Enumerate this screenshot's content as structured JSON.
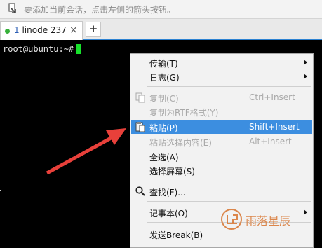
{
  "hint_bar": {
    "icon": "add-session-hint-icon",
    "text": "要添加当前会话，点击左侧的箭头按钮。"
  },
  "tabs": [
    {
      "number": "1",
      "name": "linode 237",
      "status_color": "#36b03a",
      "active": true
    }
  ],
  "tab_bar": {
    "close_glyph": "×",
    "add_glyph": "+"
  },
  "terminal": {
    "prompt": "root@ubuntu:~#",
    "cursor_color": "#17e22b"
  },
  "context_menu": {
    "highlight_color": "#3c8ee0",
    "items": {
      "transfer": {
        "label": "传输(T)",
        "submenu": true
      },
      "log": {
        "label": "日志(G)",
        "submenu": true
      },
      "copy": {
        "label": "复制(C)",
        "shortcut": "Ctrl+Insert",
        "disabled": true,
        "icon": "copy-icon"
      },
      "copy_rtf": {
        "label": "复制为RTF格式(Y)",
        "disabled": true
      },
      "paste": {
        "label": "粘贴(P)",
        "shortcut": "Shift+Insert",
        "selected": true,
        "icon": "paste-icon"
      },
      "paste_selection": {
        "label": "粘贴选择内容(E)",
        "shortcut": "Alt+Insert",
        "disabled": true
      },
      "select_all": {
        "label": "全选(A)"
      },
      "select_screen": {
        "label": "选择屏幕(S)"
      },
      "find": {
        "label": "查找(F)...",
        "icon": "magnifier-icon"
      },
      "notepad": {
        "label": "记事本(O)",
        "submenu": true
      },
      "send_break": {
        "label": "发送Break(B)"
      }
    }
  },
  "annotation": {
    "arrow_color": "#e8403a"
  },
  "watermark": {
    "text": "雨落星辰",
    "logo": "watermark-logo-icon",
    "color": "#d8742f"
  }
}
